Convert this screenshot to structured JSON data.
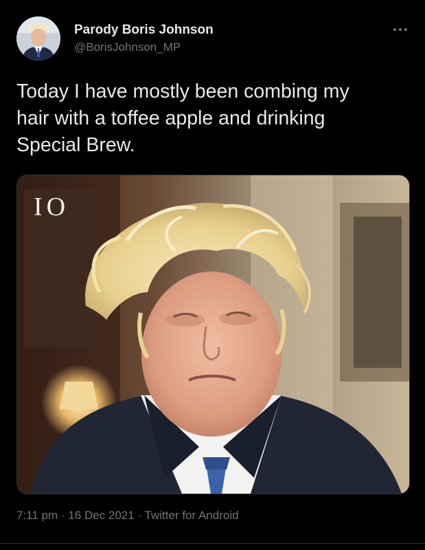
{
  "author": {
    "display_name": "Parody Boris Johnson",
    "handle": "@BorisJohnson_MP",
    "avatar_icon": "profile-photo"
  },
  "tweet": {
    "text": "Today I have mostly been combing my\nhair with a toffee apple and drinking\nSpecial Brew.",
    "media": {
      "channel_logo": "IO",
      "icon": "photo-of-man-with-messy-hair"
    }
  },
  "meta": {
    "time": "7:11 pm",
    "separator": "·",
    "date": "16 Dec 2021",
    "source": "Twitter for Android"
  },
  "more_icon": "more-options-icon",
  "colors": {
    "background": "#000000",
    "primary_text": "#e7e9ea",
    "secondary_text": "#71767b",
    "border": "#2f3336"
  }
}
